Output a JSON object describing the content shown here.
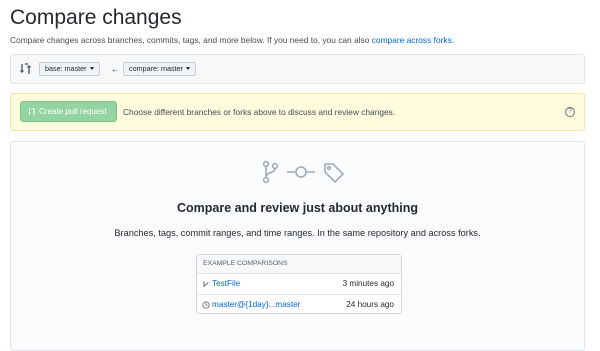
{
  "header": {
    "title": "Compare changes",
    "subtitle_prefix": "Compare changes across branches, commits, tags, and more below. If you need to, you can also ",
    "subtitle_link": "compare across forks",
    "subtitle_suffix": "."
  },
  "range": {
    "base_label": "base: master",
    "compare_label": "compare: master",
    "arrow": "←"
  },
  "flash": {
    "button_label": "Create pull request",
    "message": "Choose different branches or forks above to discuss and review changes.",
    "help_glyph": "?"
  },
  "blankslate": {
    "title": "Compare and review just about anything",
    "description": "Branches, tags, commit ranges, and time ranges. In the same repository and across forks."
  },
  "examples": {
    "header": "Example comparisons",
    "items": [
      {
        "label": "TestFile",
        "time": "3 minutes ago",
        "icon": "branch-icon"
      },
      {
        "label": "master@{1day}...master",
        "time": "24 hours ago",
        "icon": "clock-icon"
      }
    ]
  },
  "colors": {
    "link": "#0366d6",
    "pr_button": "#94d3a2",
    "flash_bg": "#fffbdd"
  }
}
